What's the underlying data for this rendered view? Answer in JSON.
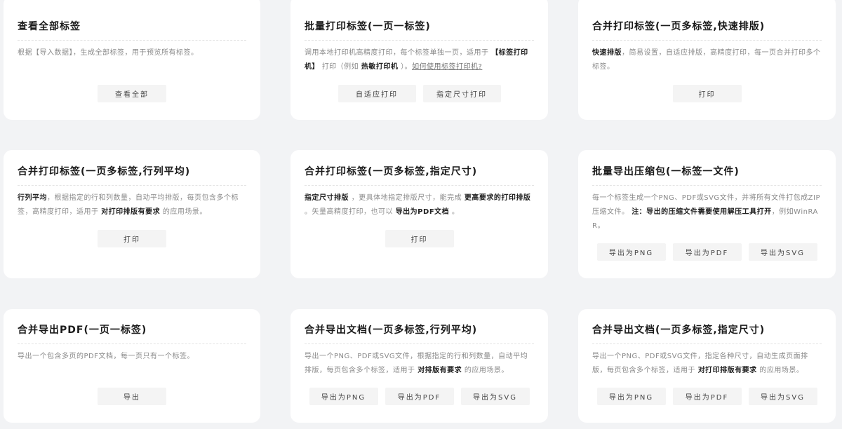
{
  "cards": [
    {
      "title": "查看全部标签",
      "desc": [
        "根据【导入数据】，生成全部标签，用于预览所有标签。"
      ],
      "buttons": [
        "查看全部"
      ]
    },
    {
      "title": "批量打印标签(一页一标签)",
      "desc": [
        "调用本地打印机高精度打印，每个标签单独一页，适用于",
        "【标签打印机】",
        "打印（例如",
        "热敏打印机",
        "）。",
        "如何使用标签打印机?"
      ],
      "buttons": [
        "自适应打印",
        "指定尺寸打印"
      ]
    },
    {
      "title": "合并打印标签(一页多标签,快速排版)",
      "desc": [
        "快速排版",
        "，简易设置，自适应排版，高精度打印，每一页合并打印多个标签。"
      ],
      "buttons": [
        "打印"
      ]
    },
    {
      "title": "合并打印标签(一页多标签,行列平均)",
      "desc": [
        "行列平均",
        "，根据指定的行和列数量，自动平均排版，每页包含多个标签，高精度打印，适用于",
        "对打印排版有要求",
        "的应用场景。"
      ],
      "buttons": [
        "打印"
      ]
    },
    {
      "title": "合并打印标签(一页多标签,指定尺寸)",
      "desc": [
        "指定尺寸排版",
        "，更具体地指定排版尺寸，能完成",
        "更高要求的打印排版",
        "。矢量高精度打印，也可以",
        "导出为PDF文档",
        "。"
      ],
      "buttons": [
        "打印"
      ]
    },
    {
      "title": "批量导出压缩包(一标签一文件)",
      "desc": [
        "每一个标签生成一个PNG、PDF或SVG文件，并将所有文件打包成ZIP压缩文件。",
        "注：导出的压缩文件需要使用解压工具打开",
        "，例如WinRAR。"
      ],
      "buttons": [
        "导出为PNG",
        "导出为PDF",
        "导出为SVG"
      ]
    },
    {
      "title": "合并导出PDF(一页一标签)",
      "desc": [
        "导出一个包含多页的PDF文档，每一页只有一个标签。"
      ],
      "buttons": [
        "导出"
      ]
    },
    {
      "title": "合并导出文档(一页多标签,行列平均)",
      "desc": [
        "导出一个PNG、PDF或SVG文件，根据指定的行和列数量，自动平均排版，每页包含多个标签，适用于",
        "对排版有要求",
        "的应用场景。"
      ],
      "buttons": [
        "导出为PNG",
        "导出为PDF",
        "导出为SVG"
      ]
    },
    {
      "title": "合并导出文档(一页多标签,指定尺寸)",
      "desc": [
        "导出一个PNG、PDF或SVG文件，指定各种尺寸，自动生成页面排版，每页包含多个标签，适用于",
        "对打印排版有要求",
        "的应用场景。"
      ],
      "buttons": [
        "导出为PNG",
        "导出为PDF",
        "导出为SVG"
      ]
    }
  ]
}
